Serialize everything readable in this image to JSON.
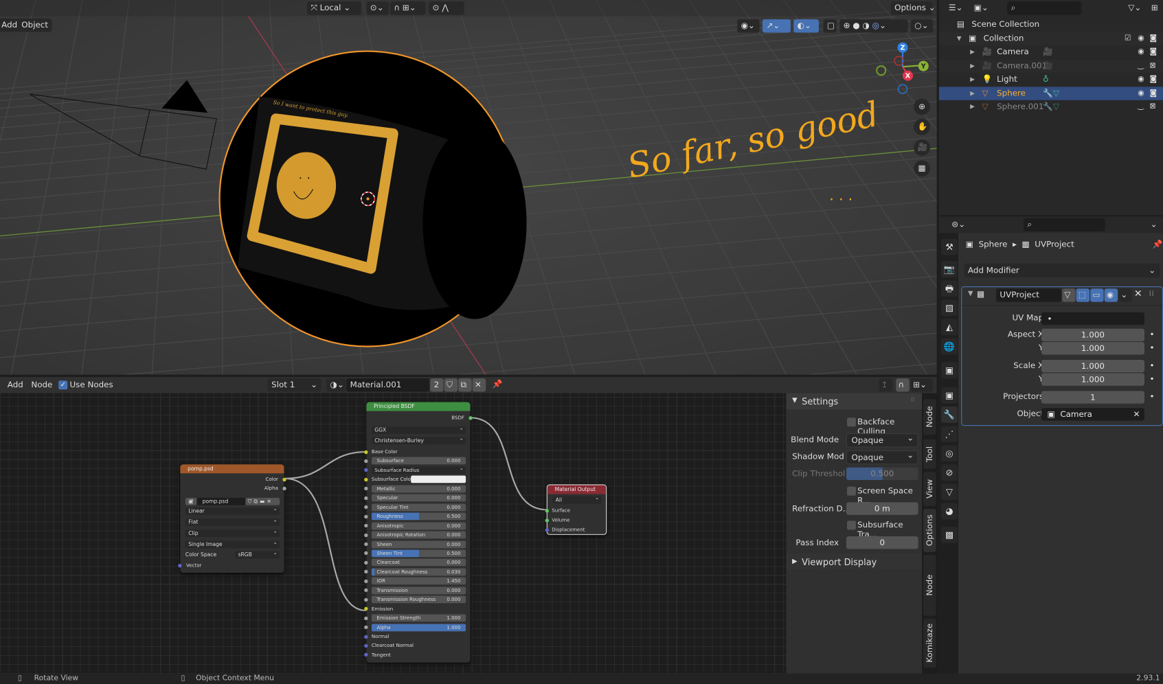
{
  "viewport": {
    "header": {
      "orientation": "Local",
      "options": "Options",
      "menus": [
        "Add",
        "Object"
      ]
    },
    "annotation": "So far, so good",
    "annotation_dots": ". . .",
    "texture_text": "So I want to protect this guy.",
    "gizmo": {
      "z": "Z",
      "y": "Y",
      "x": "X"
    },
    "colors": {
      "selection": "#f0962a",
      "annotation": "#f2a81e"
    }
  },
  "outliner": {
    "items": [
      {
        "label": "Scene Collection",
        "icon": "scene-collection-icon"
      },
      {
        "label": "Collection",
        "icon": "collection-icon"
      },
      {
        "label": "Camera",
        "icon": "camera-icon"
      },
      {
        "label": "Camera.001",
        "icon": "camera-icon"
      },
      {
        "label": "Light",
        "icon": "light-icon"
      },
      {
        "label": "Sphere",
        "icon": "mesh-icon",
        "selected": true
      },
      {
        "label": "Sphere.001",
        "icon": "mesh-icon"
      }
    ]
  },
  "properties": {
    "breadcrumb": {
      "object": "Sphere",
      "modifier": "UVProject"
    },
    "add_modifier": "Add Modifier",
    "modifier": {
      "name": "UVProject",
      "fields": [
        {
          "label": "UV Map",
          "value": "•"
        },
        {
          "label": "Aspect X",
          "value": "1.000"
        },
        {
          "label": "Y",
          "value": "1.000"
        },
        {
          "label": "Scale X",
          "value": "1.000"
        },
        {
          "label": "Y",
          "value": "1.000"
        },
        {
          "label": "Projectors",
          "value": "1"
        },
        {
          "label": "Object",
          "value": "Camera"
        }
      ]
    }
  },
  "node_editor": {
    "header": {
      "add": "Add",
      "node": "Node",
      "use_nodes": "Use Nodes",
      "use_nodes_checked": true,
      "slot": "Slot 1",
      "material": "Material.001",
      "users": "2"
    },
    "image_node": {
      "title": "pomp.psd",
      "outputs": [
        "Color",
        "Alpha"
      ],
      "image": "pomp.psd",
      "interpolation": "Linear",
      "projection": "Flat",
      "extension": "Clip",
      "source": "Single Image",
      "color_space_label": "Color Space",
      "color_space": "sRGB",
      "input": "Vector"
    },
    "bsdf_node": {
      "title": "Principled BSDF",
      "output": "BSDF",
      "distribution": "GGX",
      "subsurface_method": "Christensen-Burley",
      "rows": [
        {
          "label": "Base Color",
          "type": "socket",
          "sock": "#c7c729"
        },
        {
          "label": "Subsurface",
          "value": "0.000",
          "type": "field",
          "sock": "#a1a1a1"
        },
        {
          "label": "Subsurface Radius",
          "type": "dropdown",
          "sock": "#6363c7"
        },
        {
          "label": "Subsurface Color",
          "type": "color",
          "sock": "#c7c729"
        },
        {
          "label": "Metallic",
          "value": "0.000",
          "type": "field",
          "sock": "#a1a1a1"
        },
        {
          "label": "Specular",
          "value": "0.000",
          "type": "field",
          "sock": "#a1a1a1"
        },
        {
          "label": "Specular Tint",
          "value": "0.000",
          "type": "field",
          "sock": "#a1a1a1"
        },
        {
          "label": "Roughness",
          "value": "0.500",
          "type": "field",
          "fill": 0.5,
          "sock": "#a1a1a1"
        },
        {
          "label": "Anisotropic",
          "value": "0.000",
          "type": "field",
          "sock": "#a1a1a1"
        },
        {
          "label": "Anisotropic Rotation",
          "value": "0.000",
          "type": "field",
          "sock": "#a1a1a1"
        },
        {
          "label": "Sheen",
          "value": "0.000",
          "type": "field",
          "sock": "#a1a1a1"
        },
        {
          "label": "Sheen Tint",
          "value": "0.500",
          "type": "field",
          "fill": 0.5,
          "sock": "#a1a1a1"
        },
        {
          "label": "Clearcoat",
          "value": "0.000",
          "type": "field",
          "sock": "#a1a1a1"
        },
        {
          "label": "Clearcoat Roughness",
          "value": "0.030",
          "type": "field",
          "fill": 0.03,
          "sock": "#a1a1a1"
        },
        {
          "label": "IOR",
          "value": "1.450",
          "type": "field",
          "sock": "#a1a1a1"
        },
        {
          "label": "Transmission",
          "value": "0.000",
          "type": "field",
          "sock": "#a1a1a1"
        },
        {
          "label": "Transmission Roughness",
          "value": "0.000",
          "type": "field",
          "sock": "#a1a1a1"
        },
        {
          "label": "Emission",
          "type": "socket",
          "sock": "#c7c729"
        },
        {
          "label": "Emission Strength",
          "value": "1.000",
          "type": "field",
          "sock": "#a1a1a1"
        },
        {
          "label": "Alpha",
          "value": "1.000",
          "type": "field",
          "fill": 1,
          "sock": "#a1a1a1"
        },
        {
          "label": "Normal",
          "type": "socket",
          "sock": "#6363c7"
        },
        {
          "label": "Clearcoat Normal",
          "type": "socket",
          "sock": "#6363c7"
        },
        {
          "label": "Tangent",
          "type": "socket",
          "sock": "#6363c7"
        }
      ]
    },
    "output_node": {
      "title": "Material Output",
      "target": "All",
      "inputs": [
        "Surface",
        "Volume",
        "Displacement"
      ]
    },
    "sidebar": {
      "settings": "Settings",
      "backface": "Backface Culling",
      "blend_label": "Blend Mode",
      "blend": "Opaque",
      "shadow_label": "Shadow Mod",
      "shadow": "Opaque",
      "clip_label": "Clip Threshol",
      "clip": "0.500",
      "clip_fraction": 0.5,
      "ssr": "Screen Space R...",
      "refraction_label": "Refraction D...",
      "refraction": "0 m",
      "subsurface": "Subsurface Tra...",
      "pass_label": "Pass Index",
      "pass": "0",
      "viewport_display": "Viewport Display"
    },
    "tabs": [
      "Node",
      "Tool",
      "View",
      "Options",
      "Node Wrangler",
      "Komikaze"
    ]
  },
  "status": {
    "left": "Rotate View",
    "middle": "Object Context Menu",
    "version": "2.93.1"
  }
}
